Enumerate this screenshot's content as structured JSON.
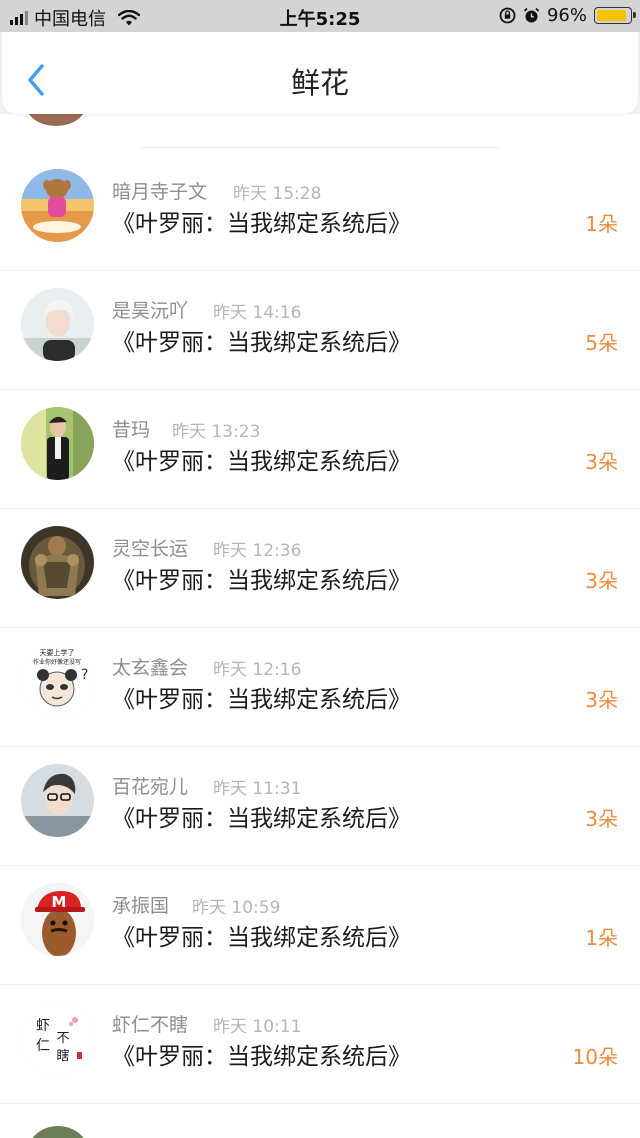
{
  "status_bar": {
    "carrier": "中国电信",
    "time": "上午5:25",
    "battery": "96%",
    "battery_level": 0.96,
    "icons": [
      "signal-icon",
      "wifi-icon",
      "rotation-lock-icon",
      "alarm-icon",
      "battery-icon"
    ]
  },
  "nav": {
    "title": "鲜花",
    "back_icon": "chevron-left-icon"
  },
  "colors": {
    "accent": "#3a9ff0",
    "count": "#f08a3c",
    "name": "#8e8e93",
    "time": "#b6b6ba"
  },
  "items": [
    {
      "name": "暗月寺子文",
      "time": "昨天 15:28",
      "book": "《叶罗丽：当我绑定系统后》",
      "count": "1朵",
      "avatar": "avatar-cartoon-girl"
    },
    {
      "name": "是昊沅吖",
      "time": "昨天 14:16",
      "book": "《叶罗丽：当我绑定系统后》",
      "count": "5朵",
      "avatar": "avatar-boy-white-hair"
    },
    {
      "name": "昔玛",
      "time": "昨天 13:23",
      "book": "《叶罗丽：当我绑定系统后》",
      "count": "3朵",
      "avatar": "avatar-boy-outdoors"
    },
    {
      "name": "灵空长运",
      "time": "昨天 12:36",
      "book": "《叶罗丽：当我绑定系统后》",
      "count": "3朵",
      "avatar": "avatar-armored-warrior"
    },
    {
      "name": "太玄鑫会",
      "time": "昨天 12:16",
      "book": "《叶罗丽：当我绑定系统后》",
      "count": "3朵",
      "avatar": "avatar-panda-meme"
    },
    {
      "name": "百花宛儿",
      "time": "昨天 11:31",
      "book": "《叶罗丽：当我绑定系统后》",
      "count": "3朵",
      "avatar": "avatar-boy-glasses"
    },
    {
      "name": "承振国",
      "time": "昨天 10:59",
      "book": "《叶罗丽：当我绑定系统后》",
      "count": "1朵",
      "avatar": "avatar-red-cap"
    },
    {
      "name": "虾仁不瞎",
      "time": "昨天 10:11",
      "book": "《叶罗丽：当我绑定系统后》",
      "count": "10朵",
      "avatar": "avatar-calligraphy"
    }
  ],
  "avatar_texts": {
    "meme_line1": "天要上学了",
    "meme_line2": "作业你好像还没写",
    "calligraphy": [
      "虾",
      "仁",
      "不",
      "瞎"
    ],
    "cap_letter": "M"
  }
}
